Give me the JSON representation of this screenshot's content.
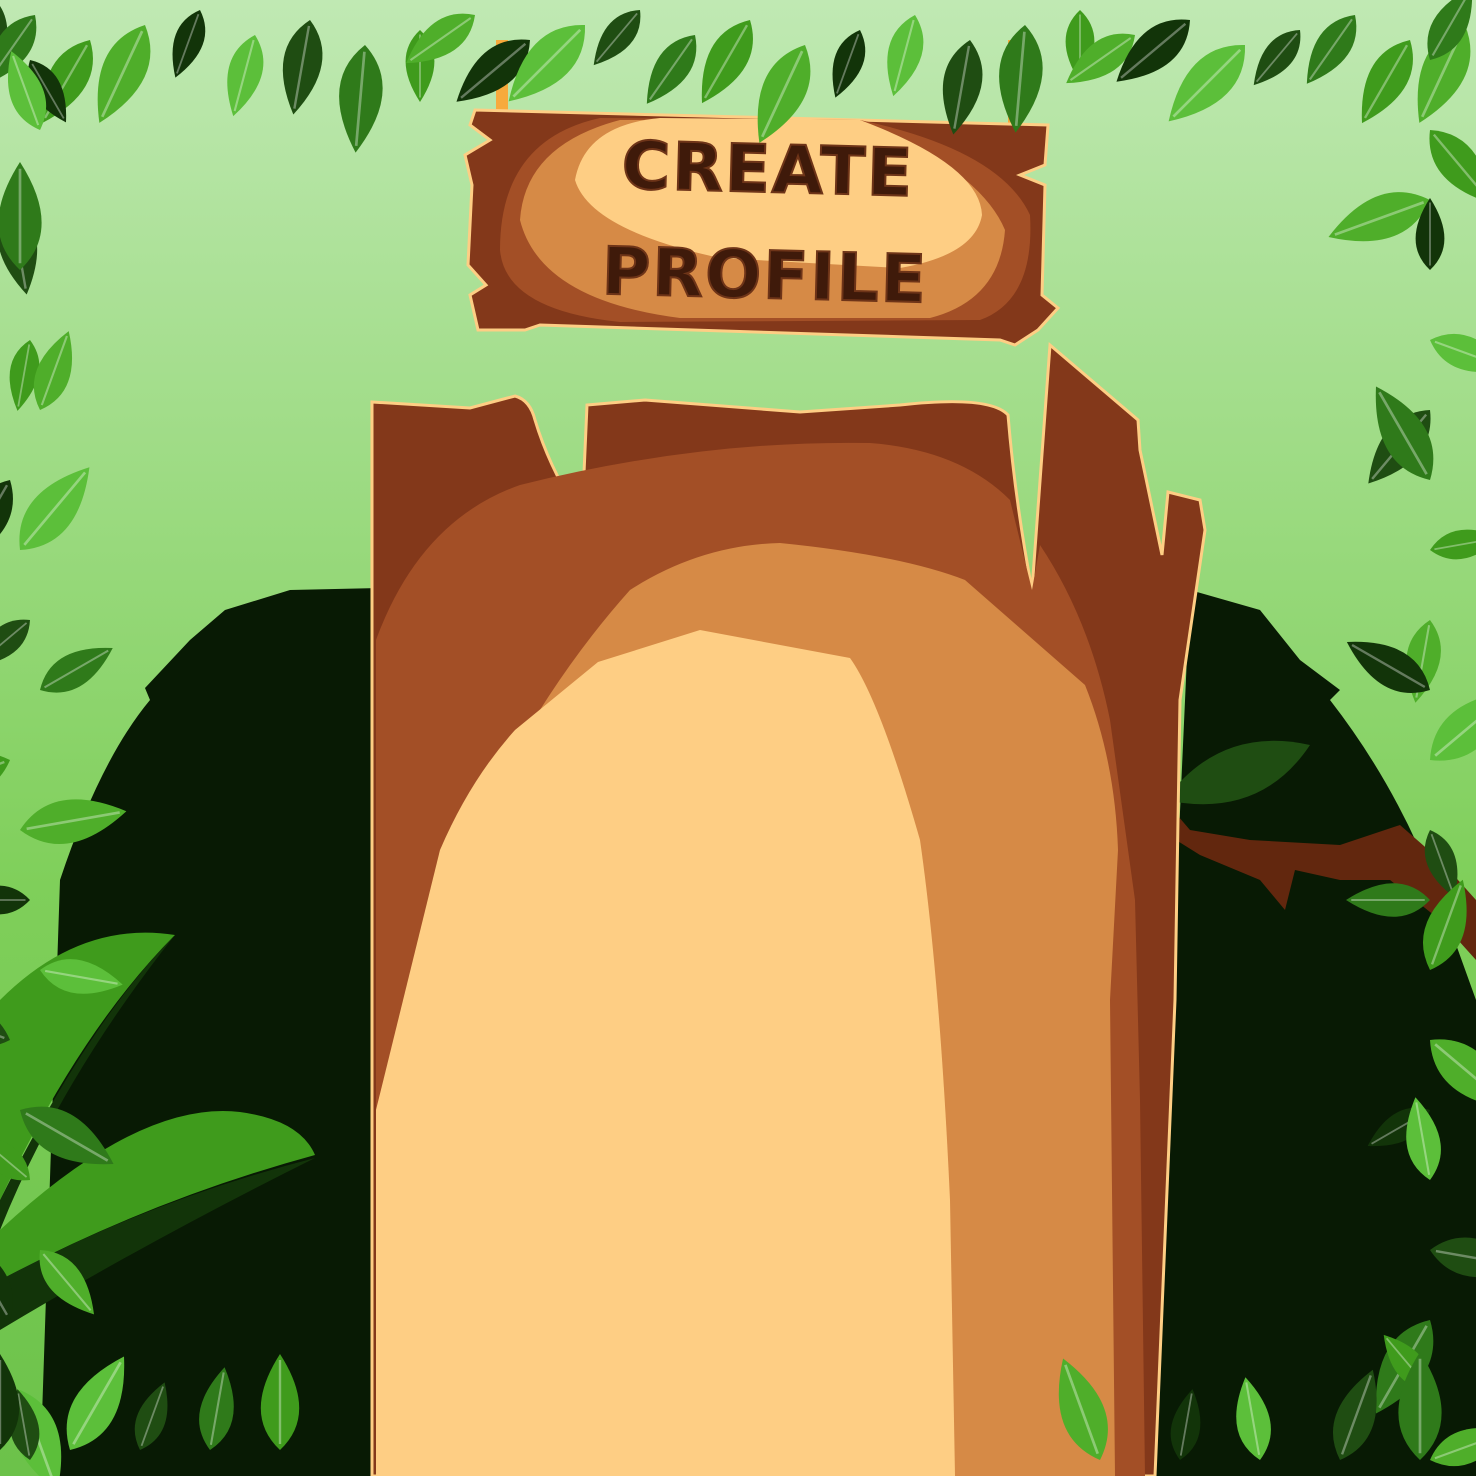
{
  "sign": {
    "line1": "CREATE",
    "line2": "PROFILE"
  },
  "colors": {
    "sky_top": "#c0e9b3",
    "sky_bottom": "#7fcf5a",
    "bush": "#081a04",
    "wood_dark": "#83381a",
    "wood_mid": "#a34f26",
    "wood_light": "#d68a46",
    "parchment": "#fece84",
    "rope": "#f7aa3c",
    "branch": "#62270e"
  },
  "icons": {
    "leaf": "leaf-icon",
    "branch": "branch-icon"
  }
}
